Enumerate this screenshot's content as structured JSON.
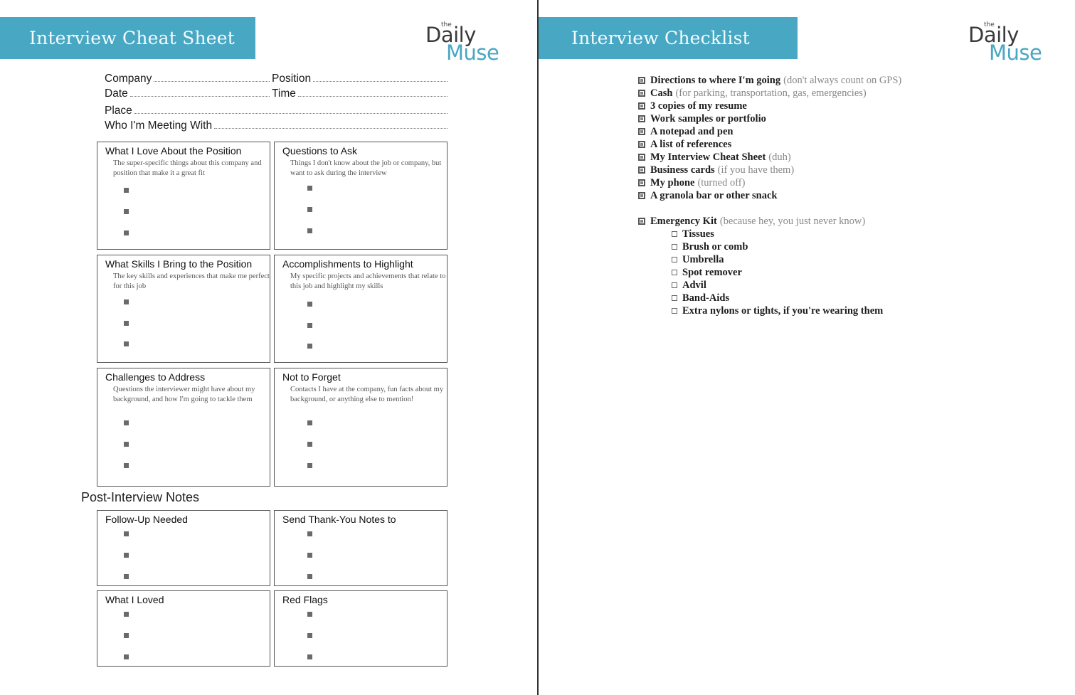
{
  "cheat_sheet": {
    "banner_title": "Interview Cheat Sheet",
    "logo": {
      "the": "the",
      "daily": "Daily",
      "muse": "Muse"
    },
    "fields": {
      "company": "Company",
      "position": "Position",
      "date": "Date",
      "time": "Time",
      "place": "Place",
      "who": "Who I'm Meeting With"
    },
    "boxes": [
      {
        "title": "What I Love About the Position",
        "desc": "The super-specific things about this company and position that make it a great fit"
      },
      {
        "title": "Questions to Ask",
        "desc": "Things I don't know about the job or company, but want to ask during the interview"
      },
      {
        "title": "What Skills I Bring to the Position",
        "desc": "The key skills and experiences that make me perfect for this job"
      },
      {
        "title": "Accomplishments to Highlight",
        "desc": "My specific projects and achievements that relate to this job and highlight my skills"
      },
      {
        "title": "Challenges to Address",
        "desc": "Questions the interviewer might have about my background, and how I'm going to tackle them"
      },
      {
        "title": "Not to Forget",
        "desc": "Contacts I have at the company, fun facts about my background, or anything else to mention!"
      }
    ],
    "post_interview": {
      "title": "Post-Interview Notes",
      "boxes": [
        {
          "title": "Follow-Up Needed"
        },
        {
          "title": "Send Thank-You Notes to"
        },
        {
          "title": "What I Loved"
        },
        {
          "title": "Red Flags"
        }
      ]
    }
  },
  "checklist": {
    "banner_title": "Interview Checklist",
    "logo": {
      "the": "the",
      "daily": "Daily",
      "muse": "Muse"
    },
    "items": [
      {
        "label": "Directions to where I'm going",
        "note": "(don't always count on GPS)"
      },
      {
        "label": "Cash",
        "note": "(for parking, transportation, gas, emergencies)"
      },
      {
        "label": "3 copies of my resume",
        "note": ""
      },
      {
        "label": "Work samples or portfolio",
        "note": ""
      },
      {
        "label": "A notepad and pen",
        "note": ""
      },
      {
        "label": "A list of references",
        "note": ""
      },
      {
        "label": "My Interview Cheat Sheet",
        "note": "(duh)"
      },
      {
        "label": "Business cards",
        "note": "(if you have them)"
      },
      {
        "label": "My phone",
        "note": "(turned off)"
      },
      {
        "label": "A granola bar or other snack",
        "note": ""
      }
    ],
    "emergency": {
      "label": "Emergency Kit",
      "note": "(because hey, you just never know)",
      "sub_items": [
        "Tissues",
        "Brush or comb",
        "Umbrella",
        "Spot remover",
        "Advil",
        "Band-Aids",
        "Extra nylons or tights, if you're wearing them"
      ]
    }
  },
  "colors": {
    "accent": "#48a7c3",
    "logo_muse": "#4aa6c2",
    "note_gray": "#888888"
  }
}
